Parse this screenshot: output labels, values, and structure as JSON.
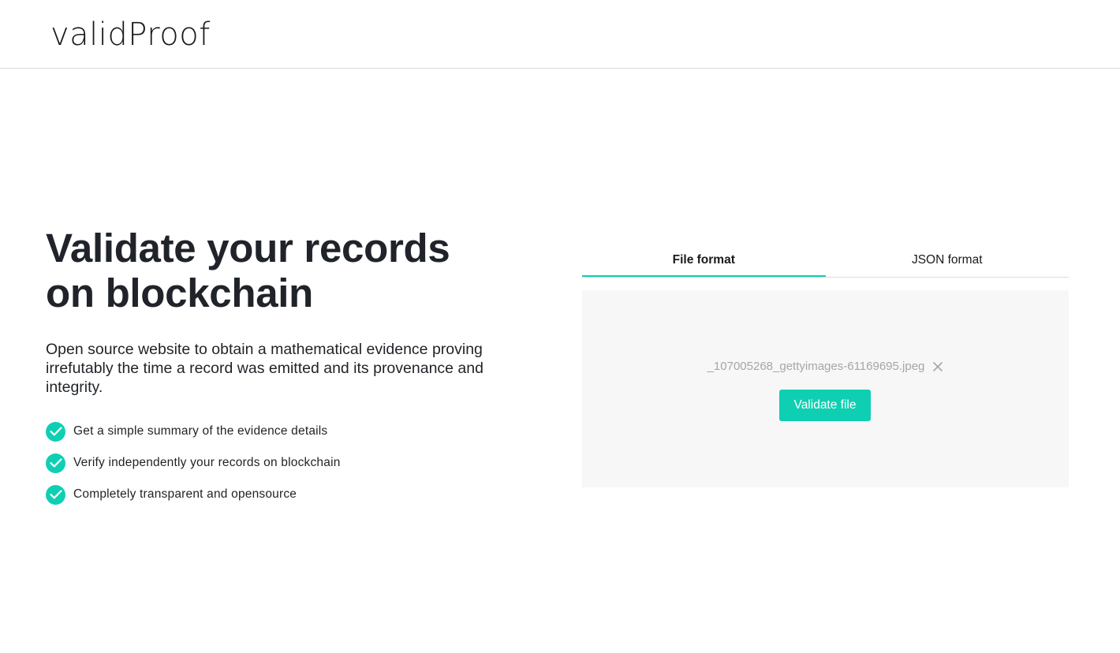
{
  "brand": {
    "logo_text": "validProof"
  },
  "hero": {
    "title_line1": "Validate your records",
    "title_line2": "on blockchain",
    "description": "Open source website to obtain a mathematical evidence proving irrefutably the time a record was emitted and its provenance and integrity.",
    "features": [
      {
        "label": "Get a simple summary of the evidence details",
        "icon": "check-circle-icon"
      },
      {
        "label": "Verify independently your records on blockchain",
        "icon": "check-circle-icon"
      },
      {
        "label": "Completely transparent and opensource",
        "icon": "check-circle-icon"
      }
    ]
  },
  "validator": {
    "tabs": [
      {
        "label": "File format",
        "active": true
      },
      {
        "label": "JSON format",
        "active": false
      }
    ],
    "selected_file": "_107005268_gettyimages-61169695.jpeg",
    "remove_icon": "close-icon",
    "validate_button_label": "Validate file"
  },
  "colors": {
    "accent": "#0fcfb2",
    "text": "#1f2327",
    "dropzone_bg": "#f7f7f7",
    "muted": "#a6a6a6"
  }
}
